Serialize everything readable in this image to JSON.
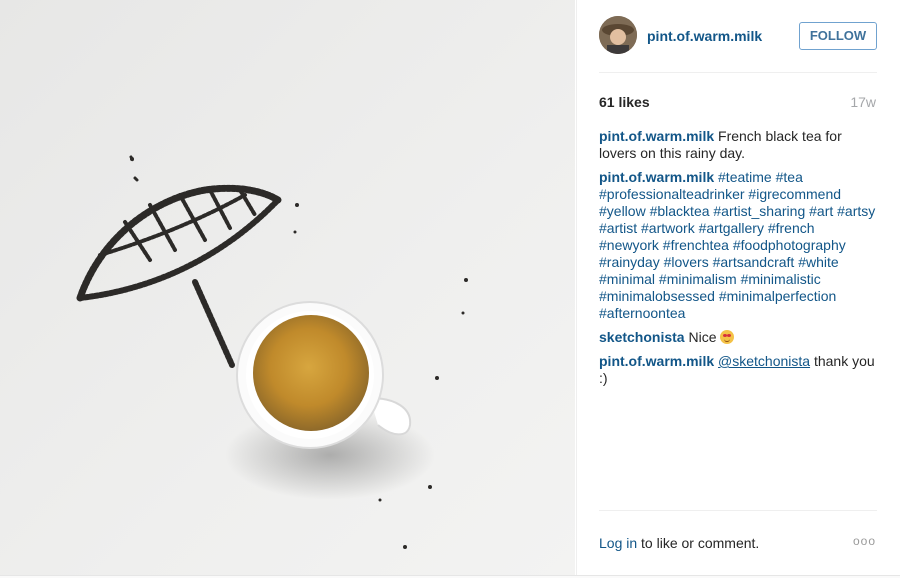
{
  "post": {
    "image_alt": "Cup of black tea with umbrella drawn in tea leaves",
    "author": {
      "username": "pint.of.warm.milk",
      "follow_label": "FOLLOW"
    },
    "likes": "61 likes",
    "age": "17w",
    "caption": {
      "user": "pint.of.warm.milk",
      "text": "French black tea for lovers on this rainy day."
    },
    "comments": [
      {
        "user": "pint.of.warm.milk",
        "tags": "#teatime #tea #professionalteadrinker #igrecommend #yellow #blacktea #artist_sharing #art #artsy #artist #artwork #artgallery #french #newyork #frenchtea #foodphotography #rainyday #lovers #artsandcraft #white #minimal #minimalism #minimalistic #minimalobsessed #minimalperfection #afternoontea"
      },
      {
        "user": "sketchonista",
        "text": "Nice",
        "emoji": "smiling-face-emoji"
      },
      {
        "user": "pint.of.warm.milk",
        "mention": "@sketchonista",
        "text": "thank you :)"
      }
    ],
    "footer": {
      "login_link": "Log in",
      "login_text": "to like or comment.",
      "more_label": "ooo"
    }
  }
}
